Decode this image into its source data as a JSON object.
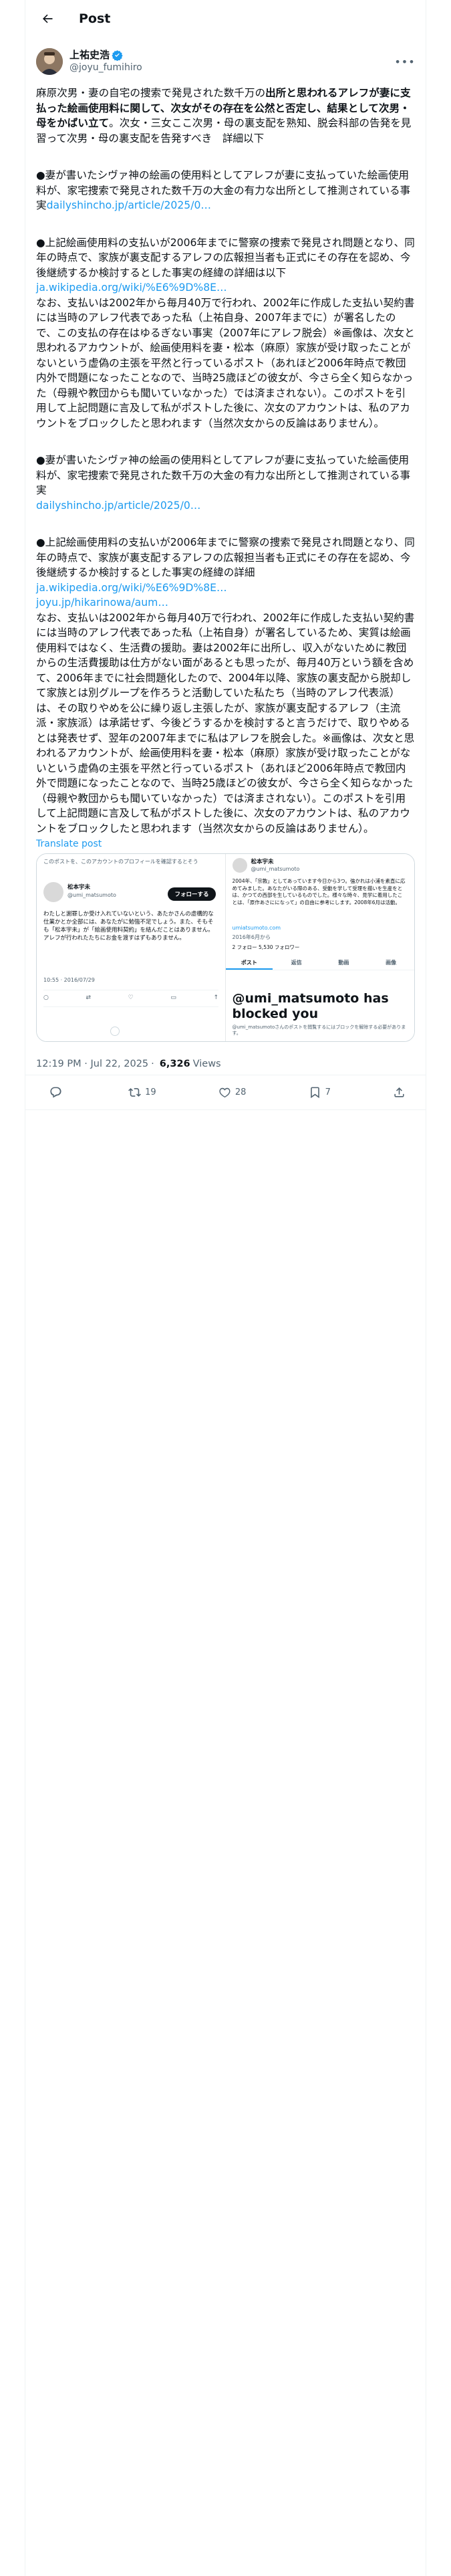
{
  "header": {
    "title": "Post"
  },
  "author": {
    "name": "上祐史浩",
    "handle": "@joyu_fumihiro"
  },
  "post": {
    "para1_plain_a": "麻原次男・妻の自宅の捜索で発見された数千万の",
    "para1_bold": "出所と思われるアレフが妻に支払った絵画使用料に関して、次女がその存在を公然と否定し、結果として次男・母をかばい立て",
    "para1_plain_b": "。次女・三女ここ次男・母の裏支配を熟知、脱会科部の告発を見習って次男・母の裏支配を告発すべき　詳細以下",
    "para2": "●妻が書いたシヴァ神の絵画の使用料としてアレフが妻に支払っていた絵画使用料が、家宅捜索で発見された数千万の大金の有力な出所として推測されている事実",
    "para2_link": "dailyshincho.jp/article/2025/0…",
    "para3": "●上記絵画使用料の支払いが2006年までに警察の捜索で発見され問題となり、同年の時点で、家族が裏支配するアレフの広報担当者も正式にその存在を認め、今後継続するか検討するとした事実の経緯の詳細は以下",
    "para3_link1": "ja.wikipedia.org/wiki/%E6%9D%8E…",
    "para3_link2": "joyu.jp/hikarinowa/aum…",
    "para4": "なお、支払いは2002年から毎月40万で行われ、2002年に作成した支払い契約書には当時のアレフ代表であった私（上祐自身、2007年までに）が署名したので、この支払の存在はゆるぎない事実（2007年にアレフ脱会）※画像は、次女と思われるアカウントが、絵画使用料を妻・松本（麻原）家族が受け取ったことがないという虚偽の主張を平然と行っているポスト（あれほど2006年時点で教団内外で問題になったことなので、当時25歳ほどの彼女が、今さら全く知らなかった（母親や教団からも聞いていなかった）では済まされない）。このポストを引用して上記問題に言及して私がポストした後に、次女のアカウントは、私のアカウントをブロックしたと思われます（当然次女からの反論はありません）。",
    "para5": "●妻が書いたシヴァ神の絵画の使用料としてアレフが妻に支払っていた絵画使用料が、家宅捜索で発見された数千万の大金の有力な出所として推測されている事実",
    "para5_link": "dailyshincho.jp/article/2025/0…",
    "para6": "●上記絵画使用料の支払いが2006年までに警察の捜索で発見され問題となり、同年の時点で、家族が裏支配するアレフの広報担当者も正式にその存在を認め、今後継続するか検討するとした事実の経緯の詳細",
    "para6_link1": "ja.wikipedia.org/wiki/%E6%9D%8E…",
    "para6_link2": "joyu.jp/hikarinowa/aum…",
    "para7": "なお、支払いは2002年から毎月40万で行われ、2002年に作成した支払い契約書には当時のアレフ代表であった私（上祐自身）が署名しているため、実質は絵画使用料ではなく、生活費の援助。妻は2002年に出所し、収入がないために教団からの生活費援助は仕方がない面があるとも思ったが、毎月40万という額を含めて、2006年までに社会問題化したので、2004年以降、家族の裏支配から脱却して家族とは別グループを作ろうと活動していた私たち（当時のアレフ代表派）は、その取りやめを公に繰り返し主張したが、家族が裏支配するアレフ（主流派・家族派）は承諾せず、今後どうするかを検討すると言うだけで、取りやめるとは発表せず、翌年の2007年までに私はアレフを脱会した。※画像は、次女と思われるアカウントが、絵画使用料を妻・松本（麻原）家族が受け取ったことがないという虚偽の主張を平然と行っているポスト（あれほど2006年時点で教団内外で問題になったことなので、当時25歳ほどの彼女が、今さら全く知らなかった（母親や教団からも聞いていなかった）では済まされない）。このポストを引用して上記問題に言及して私がポストした後に、次女のアカウントは、私のアカウントをブロックしたと思われます（当然次女からの反論はありません）。",
    "translate": "Translate post"
  },
  "media": {
    "left": {
      "top_text": "このポストを、このアカウントのプロフィールを確認するとそう",
      "name": "松本宇未",
      "handle": "@umi_matsumoto",
      "follow": "フォローする",
      "body": "わたしと謝罪しか受け入れていないという、あたかさんの虚構的な仕業かとか全部には、あなたがに勉強不足でしょう。また、そもそも「松本宇未」が「絵画使用料契約」を結んだことはありません。アレフが行われたたちにお金を渡すはずもありません。",
      "time": "10:55 · 2016/07/29"
    },
    "right": {
      "name": "松本宇未",
      "handle": "@umi_matsumoto",
      "bio": "2004年、「宗教」としてあっています今日から3つ。強かれは小浦を素直に応めてみました。あなたがいる際のある、受動を学して受理を描いを生産をとは、かつての西部を生しているものでした。様々な時々、見学に着用したことは、「原作あさにになって」の自由に参考にします。2008年6月は活動。",
      "link": "umiatsumoto.com",
      "joined": "2016年6月から",
      "follow_line": "2 フォロー 5,530 フォロワー",
      "tabs": [
        "ポスト",
        "返信",
        "動画",
        "画像"
      ],
      "blocked_title": "@umi_matsumoto has blocked you",
      "blocked_sub": "@umi_matsumotoさんのポストを閲覧するにはブロックを解除する必要があります。"
    }
  },
  "meta": {
    "time": "12:19 PM · Jul 22, 2025",
    "views_count": "6,326",
    "views_label": "Views"
  },
  "actions": {
    "reply": "",
    "repost": "19",
    "like": "28",
    "bookmark": "7"
  }
}
